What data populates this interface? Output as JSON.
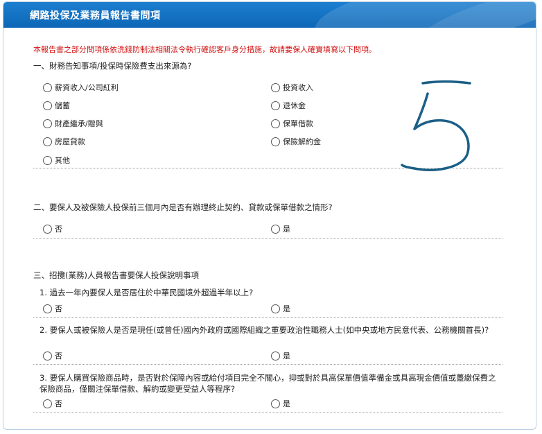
{
  "header": {
    "title": "網路投保及業務員報告書問項"
  },
  "notice": "本報告書之部分問項係依洗錢防制法相關法令執行確認客戶身分措施，故請要保人確實填寫以下問項。",
  "q1": {
    "heading": "一、財務告知事項/投保時保險費支出來源為?",
    "options_left": [
      "薪資收入/公司紅利",
      "儲蓄",
      "財產繼承/贈與",
      "房屋貸款",
      "其他"
    ],
    "options_right": [
      "投資收入",
      "退休金",
      "保單借款",
      "保險解約金"
    ]
  },
  "q2": {
    "heading": "二、要保人及被保險人投保前三個月內是否有辦理終止契約、貸款或保單借款之情形?",
    "no": "否",
    "yes": "是"
  },
  "q3": {
    "heading": "三、招攬(業務)人員報告書要保人投保說明事項",
    "items": [
      {
        "text": "1. 過去一年內要保人是否居住於中華民國境外超過半年以上?",
        "no": "否",
        "yes": "是"
      },
      {
        "text": "2. 要保人或被保險人是否是現任(或曾任)國內外政府或國際組織之重要政治性職務人士(如中央或地方民意代表、公務機關首長)?",
        "no": "否",
        "yes": "是"
      },
      {
        "text": "3. 要保人購買保險商品時，是否對於保障內容或給付項目完全不關心，抑或對於具高保單價值準備金或具高現金價值或躉繳保費之保險商品，僅關注保單借款、解約或變更受益人等程序?",
        "no": "否",
        "yes": "是"
      }
    ]
  },
  "colors": {
    "header": "#0d66b6",
    "notice": "#d01010",
    "scribble": "#1a5f86"
  }
}
